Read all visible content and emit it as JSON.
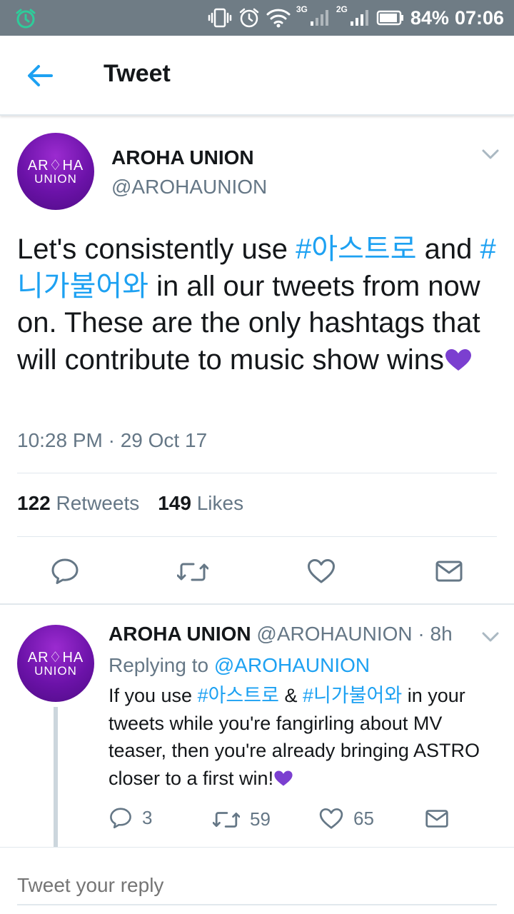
{
  "status_bar": {
    "net_3g": "3G",
    "net_2g": "2G",
    "battery": "84%",
    "time": "07:06",
    "icons": [
      "alarm-clock-icon",
      "vibrate-icon",
      "alarm-icon",
      "wifi-icon",
      "signal-icon",
      "battery-icon"
    ]
  },
  "app_bar": {
    "title": "Tweet"
  },
  "main_tweet": {
    "name": "AROHA UNION",
    "handle": "@AROHAUNION",
    "avatar_line1": "AR♢HA",
    "avatar_line2": "UNION",
    "text_1": "Let's consistently use ",
    "hashtag_1": "#아스트로",
    "text_2": " and ",
    "hashtag_2": "#니가불어와",
    "text_3": " in all our tweets from now on. These are the only hashtags that will contribute to music show wins",
    "time": "10:28 PM · 29 Oct 17",
    "retweet_count": "122",
    "retweet_label": "Retweets",
    "like_count": "149",
    "like_label": "Likes"
  },
  "reply": {
    "name": "AROHA UNION",
    "meta": " @AROHAUNION · 8h",
    "avatar_line1": "AR♢HA",
    "avatar_line2": "UNION",
    "replying_label": "Replying to ",
    "replying_handle": "@AROHAUNION",
    "text_1": "If you use ",
    "hashtag_1": "#아스트로",
    "text_2": " & ",
    "hashtag_2": "#니가불어와",
    "text_3": " in your tweets while you're fangirling about MV teaser, then you're already bringing ASTRO closer to a first win!",
    "reply_count": "3",
    "retweet_count": "59",
    "like_count": "65"
  },
  "reply_box": {
    "placeholder": "Tweet your reply"
  },
  "colors": {
    "status_bar": "#6f7c85",
    "accent": "#1da1f2",
    "muted": "#657786",
    "heart": "#7b3fd0",
    "avatar": "#6b12a8"
  }
}
